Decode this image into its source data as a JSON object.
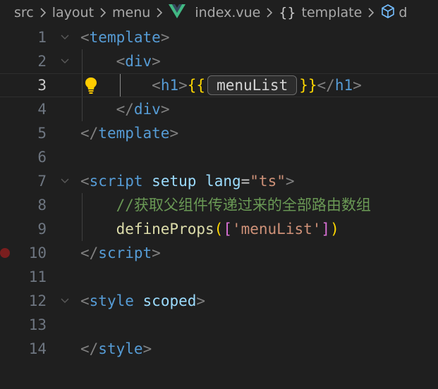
{
  "breadcrumb": {
    "items": [
      "src",
      "layout",
      "menu",
      "index.vue",
      "template",
      "d"
    ],
    "braces": "{}",
    "icons": {
      "separator": "chevron-right-icon",
      "file": "vue-logo-icon",
      "symbol": "braces-icon",
      "element": "cube-icon"
    }
  },
  "editor": {
    "line_numbers": [
      "1",
      "2",
      "3",
      "4",
      "5",
      "6",
      "7",
      "8",
      "9",
      "10",
      "11",
      "12",
      "13",
      "14"
    ],
    "active_line": "3",
    "breakpoint_line": "10",
    "code": {
      "l1": {
        "open": "<",
        "tag": "template",
        "close": ">"
      },
      "l2": {
        "open": "<",
        "tag": "div",
        "close": ">"
      },
      "l3": {
        "open": "<",
        "tag": "h1",
        "close": ">",
        "mustache_open": "{{",
        "variable": "menuList",
        "mustache_close": "}}",
        "end_open": "</",
        "end_tag": "h1",
        "end_close": ">"
      },
      "l4": {
        "open": "</",
        "tag": "div",
        "close": ">"
      },
      "l5": {
        "open": "</",
        "tag": "template",
        "close": ">"
      },
      "l7": {
        "open": "<",
        "tag": "script",
        "attr1": "setup",
        "attr2": "lang",
        "eq": "=",
        "value": "\"ts\"",
        "close": ">"
      },
      "l8": {
        "comment": "//获取父组件传递过来的全部路由数组"
      },
      "l9": {
        "fn": "defineProps",
        "paren_open": "(",
        "bracket_open": "[",
        "str": "'menuList'",
        "bracket_close": "]",
        "paren_close": ")"
      },
      "l10": {
        "open": "</",
        "tag": "script",
        "close": ">"
      },
      "l12": {
        "open": "<",
        "tag": "style",
        "attr": "scoped",
        "close": ">"
      },
      "l14": {
        "open": "</",
        "tag": "style",
        "close": ">"
      }
    }
  },
  "colors": {
    "background": "#1f1f1f",
    "tag": "#569cd6",
    "attribute": "#9cdcfe",
    "string": "#ce9178",
    "comment": "#6a9955",
    "function": "#dcdcaa",
    "brace": "#ffd700",
    "bracket": "#da70d6",
    "breakpoint": "#7a1e1e",
    "lightbulb": "#ffcc00"
  }
}
